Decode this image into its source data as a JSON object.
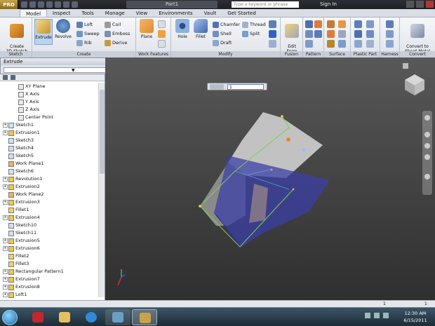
{
  "titlebar": {
    "app_badge": "PRO",
    "document_title": "Part1",
    "search_placeholder": "Type a keyword or phrase",
    "sign_in": "Sign In"
  },
  "tabs": [
    "Model",
    "Inspect",
    "Tools",
    "Manage",
    "View",
    "Environments",
    "Vault",
    "Get Started"
  ],
  "ribbon": {
    "sketch": {
      "label": "Sketch",
      "create_sketch": "Create\n3D Sketch"
    },
    "create": {
      "label": "Create",
      "extrude": "Extrude",
      "revolve": "Revolve",
      "loft": "Loft",
      "sweep": "Sweep",
      "rib": "Rib",
      "coil": "Coil",
      "emboss": "Emboss",
      "derive": "Derive"
    },
    "work_features": {
      "label": "Work Features",
      "plane": "Plane"
    },
    "modify": {
      "label": "Modify",
      "hole": "Hole",
      "fillet": "Fillet",
      "chamfer": "Chamfer",
      "shell": "Shell",
      "draft": "Draft",
      "thread": "Thread",
      "split": "Split"
    },
    "fusion": {
      "label": "Fusion",
      "edit_form": "Edit\nForm"
    },
    "pattern": {
      "label": "Pattern"
    },
    "surface": {
      "label": "Surface"
    },
    "plastic_part": {
      "label": "Plastic Part"
    },
    "harness": {
      "label": "Harness"
    },
    "convert": {
      "label": "Convert",
      "convert_sheet_metal": "Convert to\nSheet Metal"
    }
  },
  "extrude_dialog": {
    "title": "Extrude"
  },
  "browser": {
    "items": [
      {
        "label": "XY Plane",
        "indent": 2,
        "expand": false
      },
      {
        "label": "X Axis",
        "indent": 2,
        "expand": false
      },
      {
        "label": "Y Axis",
        "indent": 2,
        "expand": false
      },
      {
        "label": "Z Axis",
        "indent": 2,
        "expand": false
      },
      {
        "label": "Center Point",
        "indent": 2,
        "expand": false
      },
      {
        "label": "Sketch1",
        "indent": 1,
        "expand": true
      },
      {
        "label": "Extrusion1",
        "indent": 1,
        "expand": true
      },
      {
        "label": "Sketch3",
        "indent": 1,
        "expand": false
      },
      {
        "label": "Sketch4",
        "indent": 1,
        "expand": false
      },
      {
        "label": "Sketch5",
        "indent": 1,
        "expand": false
      },
      {
        "label": "Work Plane1",
        "indent": 1,
        "expand": false
      },
      {
        "label": "Sketch6",
        "indent": 1,
        "expand": false
      },
      {
        "label": "Revolution1",
        "indent": 1,
        "expand": true
      },
      {
        "label": "Extrusion2",
        "indent": 1,
        "expand": true
      },
      {
        "label": "Work Plane2",
        "indent": 1,
        "expand": false
      },
      {
        "label": "Extrusion3",
        "indent": 1,
        "expand": true
      },
      {
        "label": "Fillet1",
        "indent": 1,
        "expand": false
      },
      {
        "label": "Extrusion4",
        "indent": 1,
        "expand": true
      },
      {
        "label": "Sketch10",
        "indent": 1,
        "expand": false
      },
      {
        "label": "Sketch11",
        "indent": 1,
        "expand": false
      },
      {
        "label": "Extrusion5",
        "indent": 1,
        "expand": true
      },
      {
        "label": "Extrusion6",
        "indent": 1,
        "expand": true
      },
      {
        "label": "Fillet2",
        "indent": 1,
        "expand": false
      },
      {
        "label": "Fillet3",
        "indent": 1,
        "expand": false
      },
      {
        "label": "Rectangular Pattern1",
        "indent": 1,
        "expand": true
      },
      {
        "label": "Extrusion7",
        "indent": 1,
        "expand": true
      },
      {
        "label": "Extrusion8",
        "indent": 1,
        "expand": true
      },
      {
        "label": "Loft1",
        "indent": 1,
        "expand": true
      }
    ]
  },
  "viewport": {
    "distance_value": "1"
  },
  "statusbar": {
    "count_left": "1",
    "count_right": "1"
  },
  "taskbar": {
    "time": "12:30 AM",
    "date": "6/15/2011"
  },
  "colors": {
    "accent": "#3a5ea8",
    "body_face": "#3b3fa6",
    "body_top": "#c9c9c9"
  }
}
